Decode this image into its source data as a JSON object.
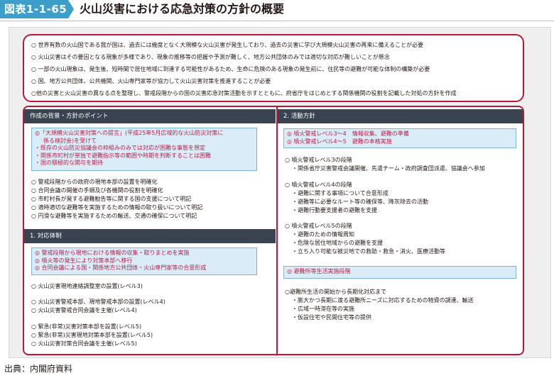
{
  "figure": {
    "label": "図表1-1-65",
    "title": "火山災害における応急対策の方針の概要"
  },
  "overview": [
    "○ 世界有数の火山国である我が国は、過去には幾度となく大規模な火山災害が発生しており、過去の災害に学び大規模火山災害の再来に備えることが必要",
    "○ 火山災害はその要因となる現象が多様であり、現象の推移等の把握や予測が難しく、地方公共団体のみでは適切な対応が難しいことが懸念",
    "○ 一部の火山現象は、発生後、短時間で居住地域に到達する可能性があるため、生命に危険のある現象の発生前に、住民等の避難が可能な体制の構築が必要",
    "○ 国、地方公共団体、公共機関、火山専門家等が協力して火山災害対策を推進することが必要",
    "○他の災害と火山災害の異なる点を整理し、警戒段階からの国の災害応急対策活動を示すとともに、府省庁をはじめとする関係機関の役割を記載した対処の方針を作成"
  ],
  "left": {
    "background_header": "作成の背景・方針のポイント",
    "background_box": [
      "◎「大規模火山災害対策への提言」(平成25年5月広域的な火山防災対策に",
      "係る検討会)を受けて",
      "・既存の火山防災協議会の枠組みのみでは対応が困難な事態を想定",
      "・関係市町村が単独で避難指示等の範囲や時期を判断することは困難",
      "・国の積極的な関与を期待"
    ],
    "background_points": [
      "○ 警戒段階からの政府の現地本部の設置を明確化",
      "○ 合同会議の開催の手順及び各機関の役割を明確化",
      "○ 市町村長が発する避難勧告等に関する国の支援について明記",
      "○ 適時適切な避難等を実施するための情報の取り扱いについて明記",
      "○ 円滑な避難等を実施するための輸送、交通の確保について明記"
    ],
    "structure_header": "1. 対応体制",
    "structure_box": [
      "◎ 警戒段階から現地における情報の収集・取りまとめを実施",
      "◎ 噴火等の発生により対策本部へ移行",
      "◎ 合同会議による国・関係地方公共団体・火山専門家等の合意形成"
    ],
    "structure_group1": [
      "○ 火山災害現地連絡調整室の設置(レベル3)"
    ],
    "structure_group2": [
      "○ 火山災害警戒本部、現地警戒本部の設置(レベル4)",
      "○ 火山災害警戒合同会議を主催(レベル4)"
    ],
    "structure_group3": [
      "○ 緊急(非常)災害対策本部を設置(レベル5)",
      "○ 緊急(非常)災害現地対策本部を設置(レベル5)",
      "○ 火山災害対策合同会議を主催(レベル5)"
    ]
  },
  "right": {
    "activities_header": "2. 活動方針",
    "activities_box": [
      "◎ 噴火警戒レベル3～4　情報収集、避難の準備",
      "◎ 噴火警戒レベル4～5　避難の本格実施"
    ],
    "level3": [
      "○ 噴火警戒レベル3の段階",
      "・関係省庁災害警戒会議開催、先遣チーム・政府調査団派遣、協議会へ参加"
    ],
    "level4": [
      "○ 噴火警戒レベル4の段階",
      "・避難に関する事項について合意形成",
      "・避難等に必要なルート等の確保等、降灰除去の活動",
      "・避難行動要支援者の避難を支援"
    ],
    "level5": [
      "○ 噴火警戒レベル5の段階",
      "・避難のための情報周知",
      "・危険な居住地域からの避難を支援",
      "・立ち入り可能な被災地での救助・救急・消火、医療活動等"
    ],
    "shelter_box": "◎ 避難所等生活実施段階",
    "shelter": [
      "○避難所生活の開始から長期化対応まで",
      "・膨大かつ長期に渡る避難所ニーズに対応するための物資の調達、輸送",
      "・広域一時滞在等の実施",
      "・仮設住宅や民間住宅等の提供"
    ]
  },
  "source": "出典：内閣府資料",
  "colors": {
    "label_blue": "#3d9ec9",
    "frame_red": "#b8193a",
    "header_dark": "#3a4350",
    "box_blue": "#d9ecf7",
    "emphasis_pink": "#bb1e4b"
  }
}
